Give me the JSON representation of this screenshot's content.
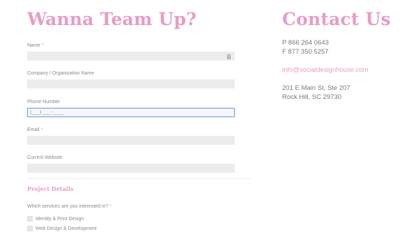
{
  "form": {
    "heading": "Wanna Team Up?",
    "fields": [
      {
        "label": "Name",
        "required": "*",
        "value": "",
        "placeholder": ""
      },
      {
        "label": "Company / Organization Name",
        "required": "",
        "value": "",
        "placeholder": ""
      },
      {
        "label": "Phone Number",
        "required": "",
        "value": "(___) ___-____",
        "placeholder": ""
      },
      {
        "label": "Email",
        "required": "*",
        "value": "",
        "placeholder": ""
      },
      {
        "label": "Current Website",
        "required": "",
        "value": "",
        "placeholder": ""
      }
    ],
    "section_title": "Project Details",
    "services_question": "Which services are you interested in?",
    "services_required": "*",
    "services": [
      {
        "label": "Identity & Print Design",
        "checked": false
      },
      {
        "label": "Web Design & Development",
        "checked": false
      }
    ]
  },
  "contact": {
    "heading": "Contact Us",
    "phone": "P 866 264 0643",
    "fax": "F 877 350 5257",
    "email": "info@socialdesignhouse.com",
    "address_line1": "201 E Main St, Ste 207",
    "address_line2": "Rock Hill, SC 29730"
  },
  "colors": {
    "accent": "#e89cc6",
    "input_bg": "#ececec",
    "focus_border": "#7fa8dc"
  },
  "icons": {
    "name_field_autofill": "contact-card-icon"
  }
}
